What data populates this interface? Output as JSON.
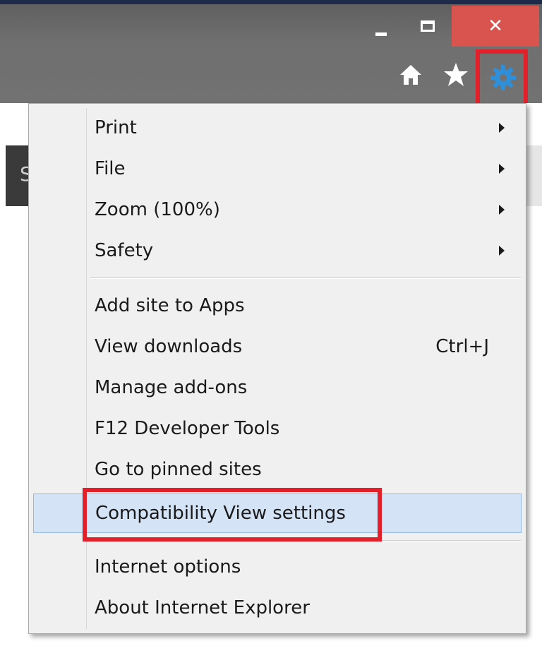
{
  "window": {
    "close_glyph": "✕"
  },
  "toolbar": {
    "icons": [
      "home-icon",
      "star-icon",
      "gear-icon"
    ],
    "gear_color": "#2f8fd8",
    "highlight_color": "#e2202c"
  },
  "page": {
    "nav_letter": "S"
  },
  "menu": {
    "items": [
      {
        "label": "Print",
        "submenu": true
      },
      {
        "label": "File",
        "submenu": true
      },
      {
        "label": "Zoom (100%)",
        "submenu": true
      },
      {
        "label": "Safety",
        "submenu": true
      },
      {
        "label": "Add site to Apps"
      },
      {
        "label": "View downloads",
        "shortcut": "Ctrl+J"
      },
      {
        "label": "Manage add-ons"
      },
      {
        "label": "F12 Developer Tools"
      },
      {
        "label": "Go to pinned sites"
      },
      {
        "label": "Compatibility View settings",
        "highlighted": true
      },
      {
        "label": "Internet options"
      },
      {
        "label": "About Internet Explorer"
      }
    ]
  }
}
